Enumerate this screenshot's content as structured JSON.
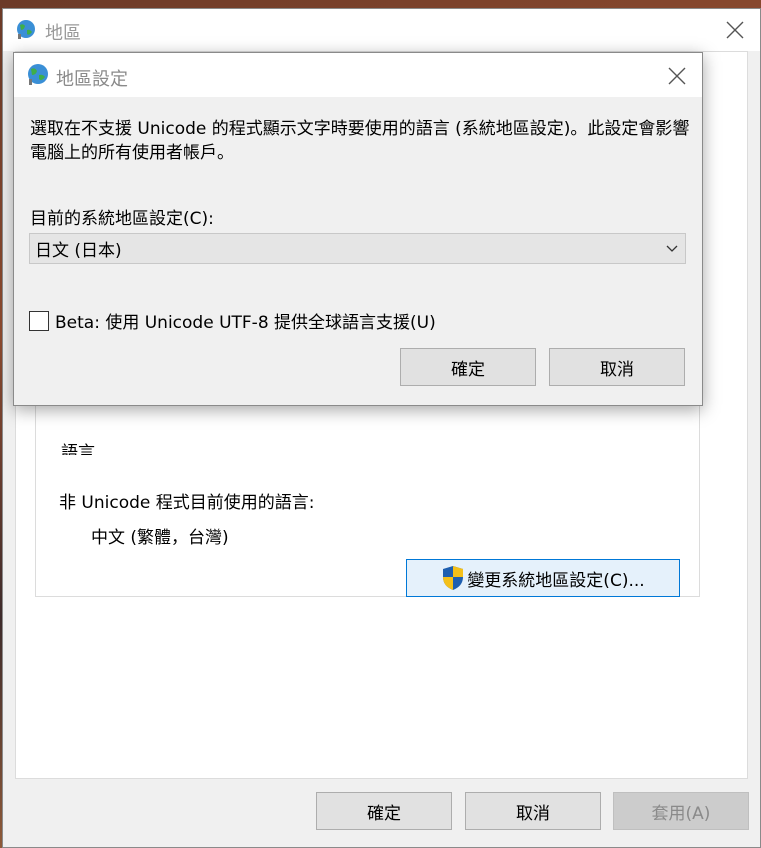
{
  "outer_window": {
    "title": "地區",
    "section_fragment": "語言",
    "current_language_label": "非 Unicode 程式目前使用的語言:",
    "current_language_value": "中文 (繁體，台灣)",
    "change_locale_button": "變更系統地區設定(C)...",
    "ok": "確定",
    "cancel": "取消",
    "apply": "套用(A)"
  },
  "dialog": {
    "title": "地區設定",
    "description": "選取在不支援 Unicode 的程式顯示文字時要使用的語言 (系統地區設定)。此設定會影響電腦上的所有使用者帳戶。",
    "locale_label": "目前的系統地區設定(C):",
    "locale_value": "日文 (日本)",
    "utf8_checkbox_label": "Beta: 使用 Unicode UTF-8 提供全球語言支援(U)",
    "utf8_checked": false,
    "ok": "確定",
    "cancel": "取消"
  },
  "icons": {
    "title_icon": "globe-icon",
    "close": "close-icon",
    "dropdown": "chevron-down-icon",
    "uac": "uac-shield-icon"
  },
  "colors": {
    "accent_border": "#0078d7",
    "button_hover_bg": "#e5f1fb",
    "button_bg": "#e1e1e1"
  }
}
